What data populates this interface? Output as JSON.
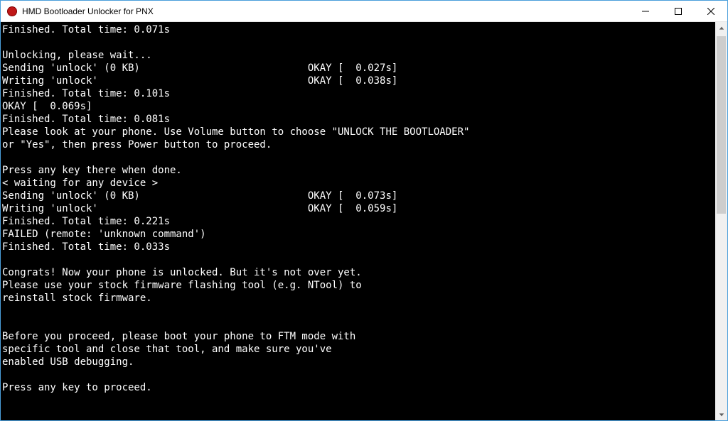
{
  "window": {
    "title": "HMD Bootloader Unlocker for PNX",
    "icon_fill": "#c01818",
    "icon_border": "#800000"
  },
  "console": {
    "lines": [
      "Finished. Total time: 0.071s",
      "",
      "Unlocking, please wait...",
      "Sending 'unlock' (0 KB)                            OKAY [  0.027s]",
      "Writing 'unlock'                                   OKAY [  0.038s]",
      "Finished. Total time: 0.101s",
      "OKAY [  0.069s]",
      "Finished. Total time: 0.081s",
      "Please look at your phone. Use Volume button to choose \"UNLOCK THE BOOTLOADER\"",
      "or \"Yes\", then press Power button to proceed.",
      "",
      "Press any key there when done.",
      "< waiting for any device >",
      "Sending 'unlock' (0 KB)                            OKAY [  0.073s]",
      "Writing 'unlock'                                   OKAY [  0.059s]",
      "Finished. Total time: 0.221s",
      "FAILED (remote: 'unknown command')",
      "Finished. Total time: 0.033s",
      "",
      "Congrats! Now your phone is unlocked. But it's not over yet.",
      "Please use your stock firmware flashing tool (e.g. NTool) to",
      "reinstall stock firmware.",
      "",
      "",
      "Before you proceed, please boot your phone to FTM mode with",
      "specific tool and close that tool, and make sure you've",
      "enabled USB debugging.",
      "",
      "Press any key to proceed."
    ]
  }
}
